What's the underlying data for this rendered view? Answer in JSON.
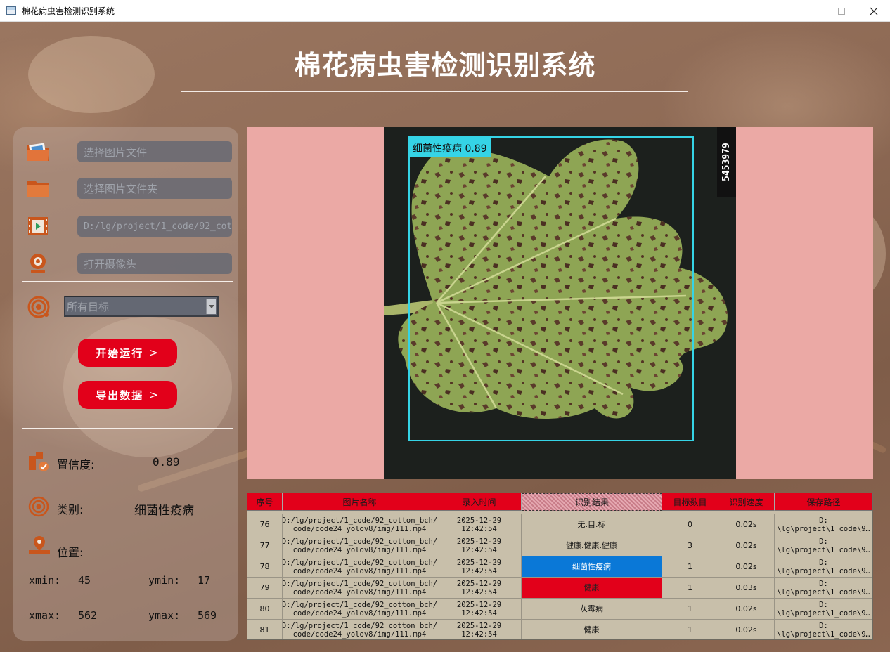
{
  "window": {
    "title": "棉花病虫害检测识别系统"
  },
  "header": {
    "title": "棉花病虫害检测识别系统"
  },
  "sources": {
    "image_file_placeholder": "选择图片文件",
    "image_folder_placeholder": "选择图片文件夹",
    "video_path_value": "D:/lg/project/1_code/92_cot",
    "camera_placeholder": "打开摄像头"
  },
  "target_select": {
    "selected": "所有目标"
  },
  "buttons": {
    "start": "开始运行",
    "export": "导出数据",
    "chevron": ">"
  },
  "info": {
    "confidence_label": "置信度:",
    "confidence_value": "0.89",
    "class_label": "类别:",
    "class_value": "细菌性疫病",
    "position_label": "位置:",
    "xmin_label": "xmin:",
    "xmin_value": "45",
    "ymin_label": "ymin:",
    "ymin_value": "17",
    "xmax_label": "xmax:",
    "xmax_value": "562",
    "ymax_label": "ymax:",
    "ymax_value": "569"
  },
  "display": {
    "detection_label": "细菌性疫病 0.89",
    "sample_id": "5453979"
  },
  "table": {
    "headers": [
      "序号",
      "图片名称",
      "录入时间",
      "识别结果",
      "目标数目",
      "识别速度",
      "保存路径"
    ],
    "rows": [
      {
        "idx": "76",
        "name": "D:/lg/project/1_code/92_cotton_bch/\ncode/code24_yolov8/img/111.mp4",
        "time": "2025-12-29\n12:42:54",
        "result": "无.目.标",
        "count": "0",
        "speed": "0.02s",
        "path": "D:\n\\lg\\project\\1_code\\9…"
      },
      {
        "idx": "77",
        "name": "D:/lg/project/1_code/92_cotton_bch/\ncode/code24_yolov8/img/111.mp4",
        "time": "2025-12-29\n12:42:54",
        "result": "健康.健康.健康",
        "count": "3",
        "speed": "0.02s",
        "path": "D:\n\\lg\\project\\1_code\\9…"
      },
      {
        "idx": "78",
        "name": "D:/lg/project/1_code/92_cotton_bch/\ncode/code24_yolov8/img/111.mp4",
        "time": "2025-12-29\n12:42:54",
        "result": "细菌性疫病",
        "count": "1",
        "speed": "0.02s",
        "path": "D:\n\\lg\\project\\1_code\\9…"
      },
      {
        "idx": "79",
        "name": "D:/lg/project/1_code/92_cotton_bch/\ncode/code24_yolov8/img/111.mp4",
        "time": "2025-12-29\n12:42:54",
        "result": "健康",
        "count": "1",
        "speed": "0.03s",
        "path": "D:\n\\lg\\project\\1_code\\9…"
      },
      {
        "idx": "80",
        "name": "D:/lg/project/1_code/92_cotton_bch/\ncode/code24_yolov8/img/111.mp4",
        "time": "2025-12-29\n12:42:54",
        "result": "灰霉病",
        "count": "1",
        "speed": "0.02s",
        "path": "D:\n\\lg\\project\\1_code\\9…"
      },
      {
        "idx": "81",
        "name": "D:/lg/project/1_code/92_cotton_bch/\ncode/code24_yolov8/img/111.mp4",
        "time": "2025-12-29\n12:42:54",
        "result": "健康",
        "count": "1",
        "speed": "0.02s",
        "path": "D:\n\\lg\\project\\1_code\\9…"
      }
    ]
  },
  "colors": {
    "accent_red": "#e2001a",
    "selection_blue": "#0a78d7",
    "detection_cyan": "#35d4e6",
    "display_bg": "#eba9a5"
  }
}
